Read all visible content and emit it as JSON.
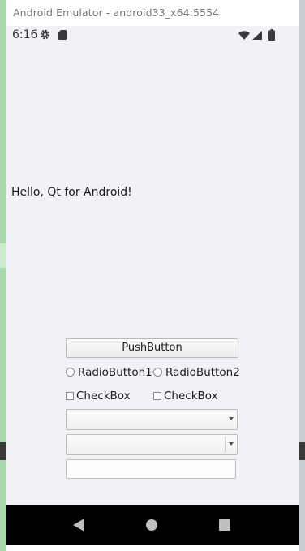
{
  "window": {
    "title": "Android Emulator - android33_x64:5554"
  },
  "status_bar": {
    "time": "6:16",
    "icons": [
      "gear-icon",
      "sd-card-icon",
      "wifi-icon",
      "signal-icon",
      "battery-icon"
    ]
  },
  "app": {
    "hello_text": "Hello, Qt for Android!",
    "push_button_label": "PushButton",
    "radio_buttons": [
      {
        "label": "RadioButton1",
        "checked": false
      },
      {
        "label": "RadioButton2",
        "checked": false
      }
    ],
    "checkboxes": [
      {
        "label": "CheckBox",
        "checked": false
      },
      {
        "label": "CheckBox",
        "checked": false
      }
    ],
    "combo_boxes": [
      {
        "selected": ""
      },
      {
        "selected": ""
      }
    ],
    "line_edit": {
      "value": "",
      "placeholder": ""
    }
  },
  "nav_bar": {
    "buttons": [
      "back-icon",
      "home-icon",
      "recents-icon"
    ]
  },
  "colors": {
    "screen_background": "#f2f1f6",
    "nav_bar": "#000000",
    "nav_icons": "#bfbfbf"
  }
}
